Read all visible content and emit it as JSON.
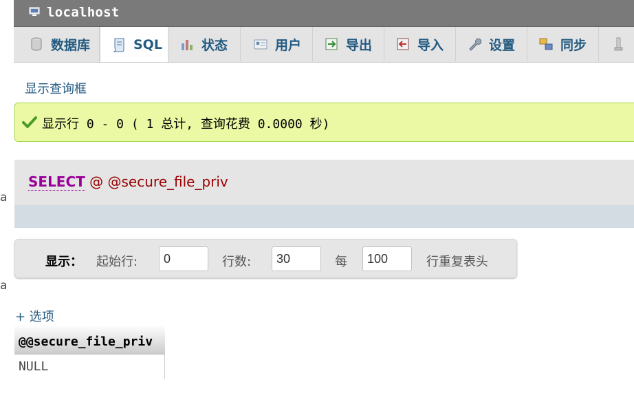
{
  "window": {
    "title": "localhost"
  },
  "edge_glyphs": [
    "a",
    "a"
  ],
  "tabs": [
    {
      "label": "数据库",
      "icon": "database-icon",
      "active": false
    },
    {
      "label": "SQL",
      "icon": "sql-scroll-icon",
      "active": true
    },
    {
      "label": "状态",
      "icon": "status-chart-icon",
      "active": false
    },
    {
      "label": "用户",
      "icon": "users-card-icon",
      "active": false
    },
    {
      "label": "导出",
      "icon": "export-icon",
      "active": false
    },
    {
      "label": "导入",
      "icon": "import-icon",
      "active": false
    },
    {
      "label": "设置",
      "icon": "wrench-icon",
      "active": false
    },
    {
      "label": "同步",
      "icon": "sync-icon",
      "active": false
    },
    {
      "label": "",
      "icon": "more-icon",
      "active": false
    }
  ],
  "query_box_toggle": "显示查询框",
  "result_message": "显示行 0 - 0 ( 1 总计, 查询花费 0.0000 秒)",
  "sql": {
    "keyword": "SELECT",
    "rest": "@ @secure_file_priv"
  },
  "navigation": {
    "show_label": "显示：",
    "start_row_label": "起始行:",
    "start_row_value": "0",
    "rows_label": "行数:",
    "rows_value": "30",
    "per_label": "每",
    "per_value": "100",
    "repeat_header_label": "行重复表头"
  },
  "options_link": "+ 选项",
  "results": {
    "columns": [
      "@@secure_file_priv"
    ],
    "rows": [
      [
        "NULL"
      ]
    ]
  },
  "colors": {
    "accent": "#235a81",
    "success_bg": "#ebf8a4",
    "keyword": "#990099"
  }
}
